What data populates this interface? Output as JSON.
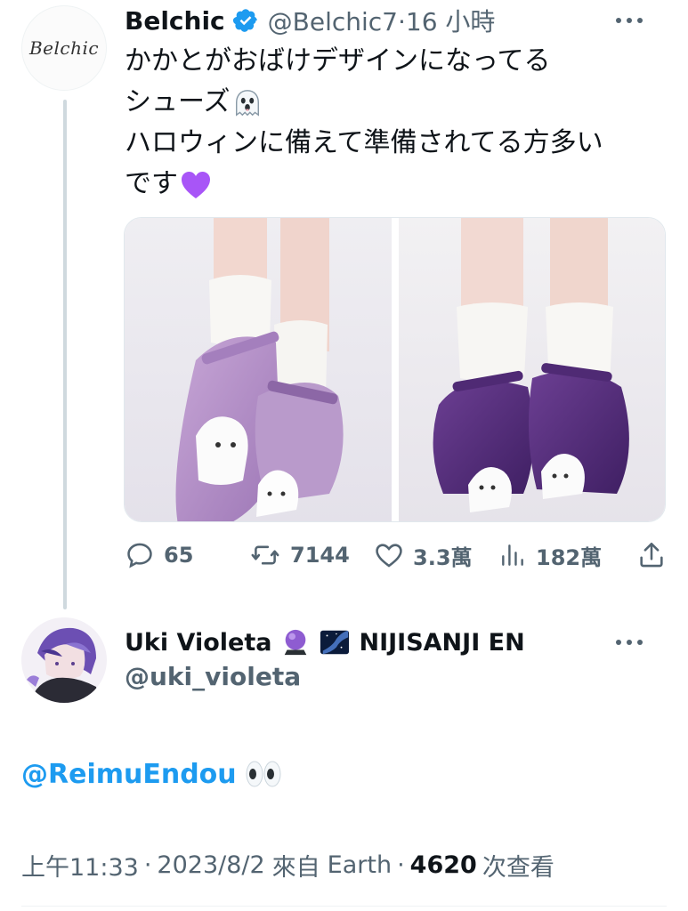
{
  "tweet": {
    "avatar_text": "Belchic",
    "author_name": "Belchic",
    "author_handle": "@Belchic7",
    "separator": "·",
    "time_ago": "16 小時",
    "text_lines": [
      "かかとがおばけデザインになってる",
      "シューズ",
      "ハロウィンに備えて準備されてる方多い",
      "です"
    ],
    "emojis": {
      "line2": "ghost",
      "line4": "purple-heart"
    },
    "stats": {
      "replies": "65",
      "retweets": "7144",
      "likes": "3.3萬",
      "views": "182萬"
    }
  },
  "reply": {
    "author_name": "Uki Violeta",
    "author_suffix": "NIJISANJI EN",
    "author_handle": "@uki_violeta",
    "badges": [
      "crystal-ball",
      "milky-way"
    ],
    "mention": "@ReimuEndou",
    "mention_emoji": "eyes",
    "timestamp": "上午11:33",
    "date": "2023/8/2",
    "source_prefix": "來自",
    "source": "Earth",
    "view_count": "4620",
    "view_label": "次查看"
  },
  "colors": {
    "text": "#0f1419",
    "secondary": "#536471",
    "link": "#1d9bf0",
    "verified": "#1d9bf0",
    "heart": "#a855f7"
  }
}
